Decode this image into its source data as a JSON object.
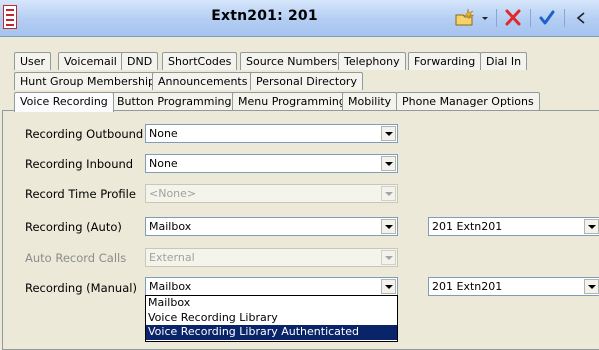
{
  "window": {
    "title": "Extn201: 201"
  },
  "toolbar": {
    "icons": [
      "new-icon",
      "dropdown-arrow-icon",
      "close-icon",
      "ok-check-icon",
      "back-arrow-icon"
    ],
    "accent_red": "#e0282d",
    "accent_blue": "#1b63c9"
  },
  "tabs": {
    "row1": [
      "User",
      "Voicemail",
      "DND",
      "ShortCodes",
      "Source Numbers",
      "Telephony",
      "Forwarding",
      "Dial In"
    ],
    "row2": [
      "Hunt Group Membership",
      "Announcements",
      "Personal Directory"
    ],
    "row3": [
      "Voice Recording",
      "Button Programming",
      "Menu Programming",
      "Mobility",
      "Phone Manager Options"
    ],
    "active": "Voice Recording"
  },
  "form": {
    "recording_outbound": {
      "label": "Recording Outbound",
      "value": "None"
    },
    "recording_inbound": {
      "label": "Recording Inbound",
      "value": "None"
    },
    "record_time_profile": {
      "label": "Record Time Profile",
      "value": "<None>"
    },
    "recording_auto": {
      "label": "Recording (Auto)",
      "value": "Mailbox",
      "target": "201 Extn201"
    },
    "auto_record_calls": {
      "label": "Auto Record Calls",
      "value": "External"
    },
    "recording_manual": {
      "label": "Recording (Manual)",
      "value": "Mailbox",
      "target": "201 Extn201"
    }
  },
  "dropdown": {
    "options": [
      "Mailbox",
      "Voice Recording Library",
      "Voice Recording Library Authenticated"
    ],
    "highlighted": "Voice Recording Library Authenticated"
  }
}
